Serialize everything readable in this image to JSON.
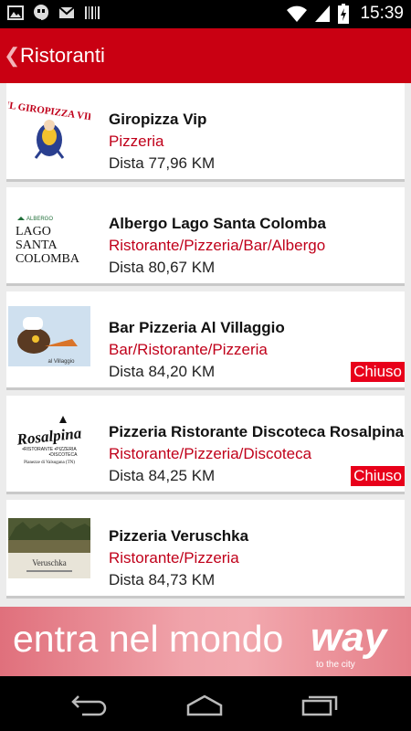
{
  "status_bar": {
    "time": "15:39",
    "left_icons": [
      "image-icon",
      "hangouts-icon",
      "gmail-icon",
      "barcode-icon"
    ],
    "right_icons": [
      "wifi-icon",
      "signal-icon",
      "battery-icon"
    ]
  },
  "app_bar": {
    "back_glyph": "❮",
    "title": "Ristoranti"
  },
  "restaurants": [
    {
      "name": "Giropizza Vip",
      "category": "Pizzeria",
      "distance": "Dista 77,96 KM",
      "status": "",
      "logo_text": "IL GIROPIZZA VIP"
    },
    {
      "name": "Albergo Lago Santa Colomba",
      "category": "Ristorante/Pizzeria/Bar/Albergo",
      "distance": "Dista 80,67 KM",
      "status": "",
      "logo_text": [
        "ALBERGO",
        "LAGO",
        "SANTA",
        "COLOMBA"
      ]
    },
    {
      "name": "Bar Pizzeria Al Villaggio",
      "category": "Bar/Ristorante/Pizzeria",
      "distance": "Dista 84,20 KM",
      "status": "Chiuso",
      "logo_text": "al Villaggio"
    },
    {
      "name": "Pizzeria Ristorante Discoteca Rosalpina",
      "category": "Ristorante/Pizzeria/Discoteca",
      "distance": "Dista 84,25 KM",
      "status": "Chiuso",
      "logo_text": [
        "Rosalpina",
        "•RISTORANTE •PIZZERIA",
        "•DISCOTECA",
        "Pianezze di Valsugana (TN)"
      ]
    },
    {
      "name": "Pizzeria Veruschka",
      "category": "Ristorante/Pizzeria",
      "distance": "Dista 84,73 KM",
      "status": "",
      "logo_text": "Veruschka"
    }
  ],
  "banner": {
    "text": "entra nel mondo",
    "logo_word": "way",
    "logo_tagline": "to the city"
  },
  "nav_bar": {
    "buttons": [
      "back-nav-icon",
      "home-nav-icon",
      "recents-nav-icon"
    ]
  },
  "colors": {
    "accent": "#c90012",
    "category_text": "#c0001a",
    "badge": "#e8001a"
  }
}
